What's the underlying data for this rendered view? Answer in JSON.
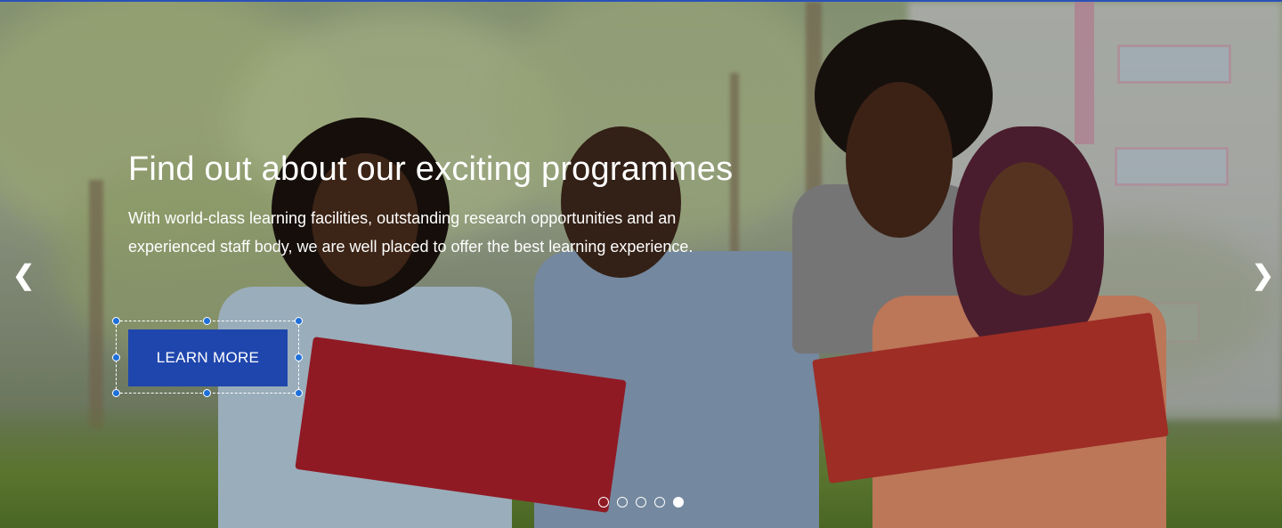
{
  "slide": {
    "title": "Find out about our exciting programmes",
    "description": "With world-class learning facilities, outstanding research opportunities and an experienced staff body, we are well placed to offer the best learning experience.",
    "button_label": "LEARN MORE"
  },
  "nav": {
    "prev_glyph": "❮",
    "next_glyph": "❯",
    "prev_icon": "chevron-left-icon",
    "next_icon": "chevron-right-icon"
  },
  "indicators": {
    "count": 5,
    "active_index": 4
  },
  "colors": {
    "button": "#1f46ad",
    "selection_handle": "#1e6fd9",
    "text": "#ffffff"
  }
}
